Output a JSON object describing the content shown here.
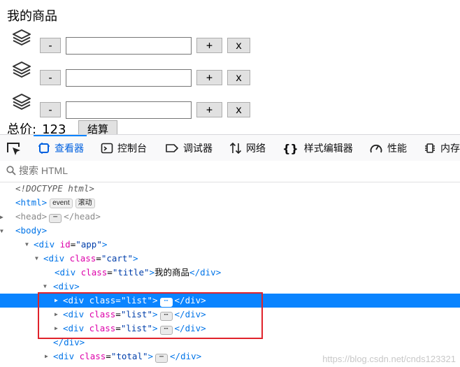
{
  "page": {
    "title": "我的商品",
    "items": [
      {
        "icon": "stack-icon",
        "minus": "-",
        "qty": "",
        "plus": "+",
        "delete": "x"
      },
      {
        "icon": "stack-icon",
        "minus": "-",
        "qty": "",
        "plus": "+",
        "delete": "x"
      },
      {
        "icon": "stack-icon",
        "minus": "-",
        "qty": "",
        "plus": "+",
        "delete": "x"
      }
    ],
    "total_label": "总价:",
    "total_value": "123",
    "checkout_label": "结算"
  },
  "devtools": {
    "tabs": [
      {
        "label": "查看器",
        "icon": "inspector-icon",
        "active": true
      },
      {
        "label": "控制台",
        "icon": "console-icon"
      },
      {
        "label": "调试器",
        "icon": "debugger-icon"
      },
      {
        "label": "网络",
        "icon": "network-icon"
      },
      {
        "label": "样式编辑器",
        "icon": "style-editor-icon"
      },
      {
        "label": "性能",
        "icon": "performance-icon"
      },
      {
        "label": "内存",
        "icon": "memory-icon"
      }
    ],
    "search_placeholder": "搜索 HTML",
    "tree": {
      "doctype": "<!DOCTYPE html>",
      "html_tag": "html",
      "badge_event": "event",
      "badge_scroll": "滚动",
      "head_tag": "head",
      "body_tag": "body",
      "app_div": {
        "tag": "div",
        "attr": "id",
        "value": "\"app\""
      },
      "cart_div": {
        "tag": "div",
        "attr": "class",
        "value": "\"cart\""
      },
      "title_div": {
        "tag": "div",
        "attr": "class",
        "value": "\"title\"",
        "text": "我的商品"
      },
      "inner_div": "div",
      "list_rows": [
        {
          "tag": "div",
          "attr": "class",
          "value": "\"list\""
        },
        {
          "tag": "div",
          "attr": "class",
          "value": "\"list\""
        },
        {
          "tag": "div",
          "attr": "class",
          "value": "\"list\""
        }
      ],
      "total_div": {
        "tag": "div",
        "attr": "class",
        "value": "\"total\""
      }
    }
  },
  "watermark": "https://blog.csdn.net/cnds123321",
  "colors": {
    "accent": "#0a84ff",
    "highlight_border": "#e0232b"
  }
}
